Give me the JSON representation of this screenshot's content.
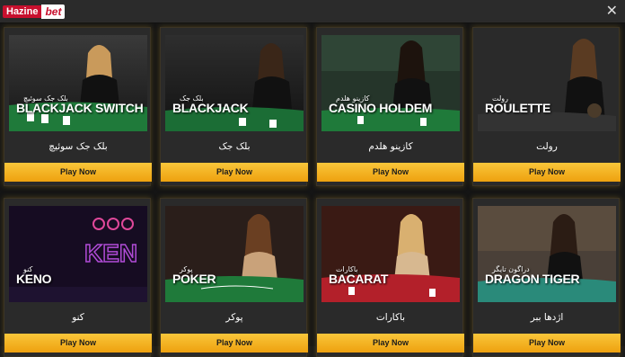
{
  "header": {
    "logo_part1": "Hazine",
    "logo_part2": "bet",
    "close_symbol": "✕"
  },
  "games": [
    {
      "name_en": "BLACKJACK SWITCH",
      "name_fa_overlay": "بلک جک سوئیچ",
      "title": "بلک جک سوئیچ",
      "play_label": "Play Now",
      "scene": "blackjack-table"
    },
    {
      "name_en": "BLACKJACK",
      "name_fa_overlay": "بلک جک",
      "title": "بلک جک",
      "play_label": "Play Now",
      "scene": "blackjack-table"
    },
    {
      "name_en": "CASINO HOLDEM",
      "name_fa_overlay": "کازینو هلدم",
      "title": "کازینو هلدم",
      "play_label": "Play Now",
      "scene": "poker-table"
    },
    {
      "name_en": "ROULETTE",
      "name_fa_overlay": "رولت",
      "title": "رولت",
      "play_label": "Play Now",
      "scene": "roulette-table"
    },
    {
      "name_en": "KENO",
      "name_fa_overlay": "کنو",
      "title": "کنو",
      "play_label": "Play Now",
      "scene": "keno-neon"
    },
    {
      "name_en": "POKER",
      "name_fa_overlay": "پوکر",
      "title": "پوکر",
      "play_label": "Play Now",
      "scene": "poker-table"
    },
    {
      "name_en": "BACARAT",
      "name_fa_overlay": "باکارات",
      "title": "باکارات",
      "play_label": "Play Now",
      "scene": "baccarat-table"
    },
    {
      "name_en": "DRAGON TIGER",
      "name_fa_overlay": "دراگون تایگر",
      "title": "اژدها ببر",
      "play_label": "Play Now",
      "scene": "dragon-table"
    }
  ],
  "colors": {
    "accent": "#f5b120",
    "brand_red": "#c8102e",
    "card_bg": "#2a2a2a",
    "table_green": "#1f7a3a"
  }
}
